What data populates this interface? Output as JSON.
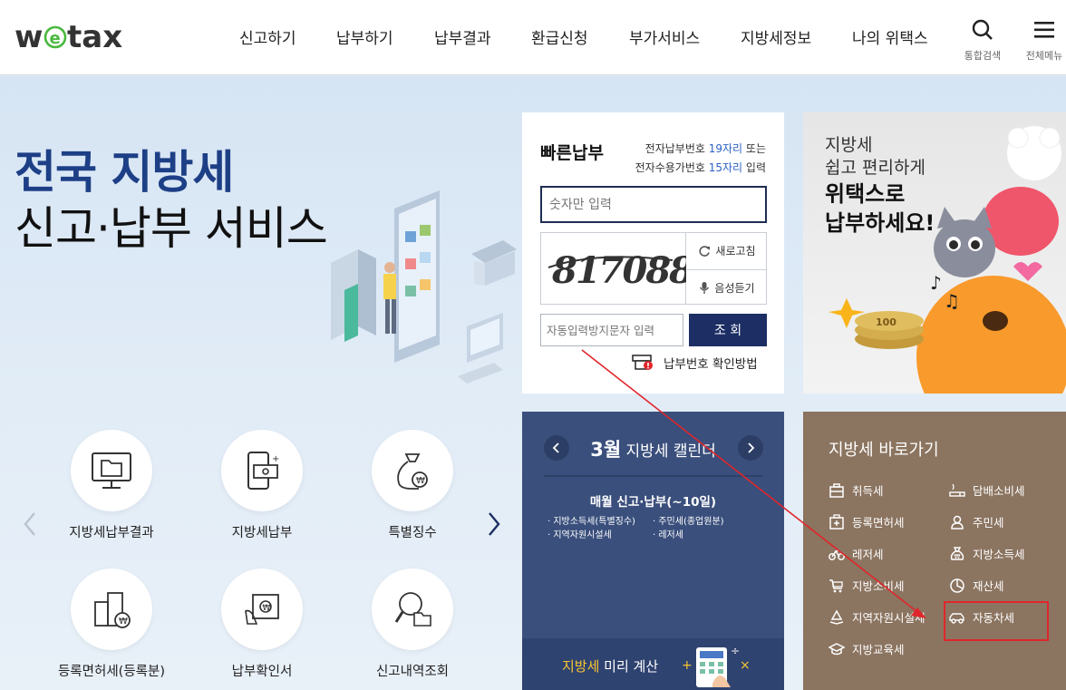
{
  "header": {
    "logo_text": "wetax",
    "nav": [
      "신고하기",
      "납부하기",
      "납부결과",
      "환급신청",
      "부가서비스",
      "지방세정보",
      "나의 위택스"
    ],
    "search_label": "통합검색",
    "menu_label": "전체메뉴"
  },
  "hero": {
    "title_line1": "전국 지방세",
    "title_line2": "신고·납부 서비스"
  },
  "quick_pay": {
    "title": "빠른납부",
    "desc_line1_a": "전자납부번호 ",
    "desc_line1_hl": "19자리",
    "desc_line1_b": " 또는",
    "desc_line2_a": "전자수용가번호 ",
    "desc_line2_hl": "15자리",
    "desc_line2_b": " 입력",
    "number_placeholder": "숫자만 입력",
    "captcha_text": "817088",
    "refresh_label": "새로고침",
    "audio_label": "음성듣기",
    "auto_placeholder": "자동입력방지문자 입력",
    "search_button": "조 회",
    "how_label": "납부번호 확인방법"
  },
  "banner": {
    "line1": "지방세",
    "line2": "쉽고 편리하게",
    "line3": "위택스로",
    "line4": "납부하세요!",
    "coin_text": "100"
  },
  "services": [
    {
      "label": "지방세납부결과",
      "icon": "monitor-folder-icon"
    },
    {
      "label": "지방세납부",
      "icon": "mobile-pay-icon"
    },
    {
      "label": "특별징수",
      "icon": "money-bag-icon"
    },
    {
      "label": "등록면허세(등록분)",
      "icon": "building-won-icon"
    },
    {
      "label": "납부확인서",
      "icon": "receipt-hand-icon"
    },
    {
      "label": "신고내역조회",
      "icon": "magnifier-folder-icon"
    }
  ],
  "calendar": {
    "month": "3월",
    "title_rest": " 지방세 캘린더",
    "subtitle": "매월 신고·납부(~10일)",
    "items": [
      "지방소득세(특별징수)",
      "주민세(종업원분)",
      "지역자원시설세",
      "레저세"
    ],
    "foot_highlight": "지방세",
    "foot_rest": " 미리 계산"
  },
  "shortcut": {
    "title": "지방세 바로가기",
    "items": [
      {
        "label": "취득세",
        "icon": "briefcase-icon"
      },
      {
        "label": "담배소비세",
        "icon": "cigarette-icon"
      },
      {
        "label": "등록면허세",
        "icon": "license-icon"
      },
      {
        "label": "주민세",
        "icon": "person-icon"
      },
      {
        "label": "레저세",
        "icon": "bicycle-icon"
      },
      {
        "label": "지방소득세",
        "icon": "money-bag-icon"
      },
      {
        "label": "지방소비세",
        "icon": "cart-icon"
      },
      {
        "label": "재산세",
        "icon": "pie-chart-icon"
      },
      {
        "label": "지역자원시설세",
        "icon": "recycle-icon"
      },
      {
        "label": "자동차세",
        "icon": "car-icon"
      },
      {
        "label": "지방교육세",
        "icon": "graduation-cap-icon"
      }
    ]
  },
  "colors": {
    "navy": "#1c2e63",
    "hero_blue": "#1d3f86",
    "highlight_blue": "#2c62c4",
    "calendar_bg": "#3a4f7c",
    "shortcut_bg": "#8b7460",
    "annotation_red": "#e0262b",
    "accent_yellow": "#f7c531"
  }
}
